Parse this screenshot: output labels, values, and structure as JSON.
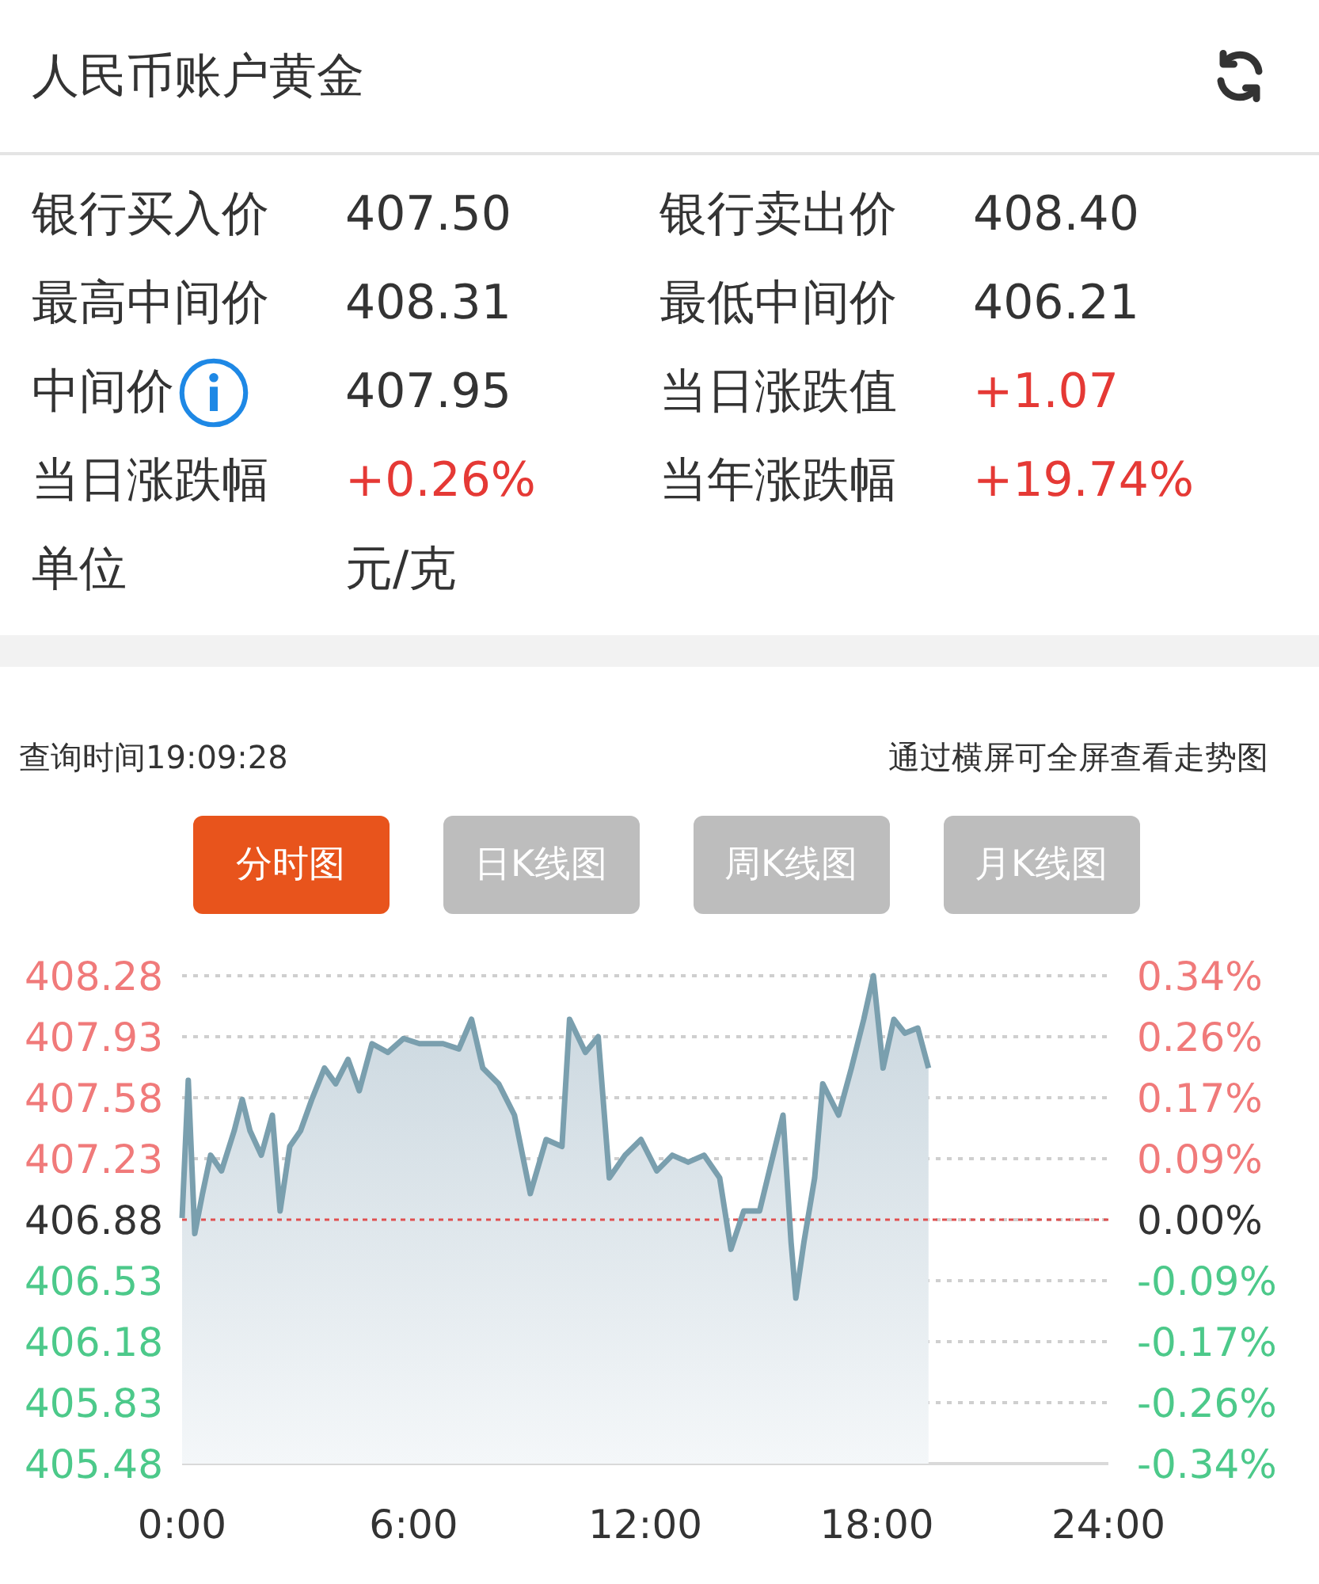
{
  "header": {
    "title": "人民币账户黄金"
  },
  "quotes": [
    {
      "label": "银行买入价",
      "value": "407.50",
      "color": "#333333",
      "info": false
    },
    {
      "label": "银行卖出价",
      "value": "408.40",
      "color": "#333333",
      "info": false
    },
    {
      "label": "最高中间价",
      "value": "408.31",
      "color": "#333333",
      "info": false
    },
    {
      "label": "最低中间价",
      "value": "406.21",
      "color": "#333333",
      "info": false
    },
    {
      "label": "中间价",
      "value": "407.95",
      "color": "#333333",
      "info": true
    },
    {
      "label": "当日涨跌值",
      "value": "+1.07",
      "color": "#e53935",
      "info": false
    },
    {
      "label": "当日涨跌幅",
      "value": "+0.26%",
      "color": "#e53935",
      "info": false
    },
    {
      "label": "当年涨跌幅",
      "value": "+19.74%",
      "color": "#e53935",
      "info": false
    },
    {
      "label": "单位",
      "value": "元/克",
      "color": "#333333",
      "info": false
    }
  ],
  "query_time": "查询时间19:09:28",
  "hint": "通过横屏可全屏查看走势图",
  "tabs": [
    {
      "label": "分时图",
      "selected": true
    },
    {
      "label": "日K线图",
      "selected": false
    },
    {
      "label": "周K线图",
      "selected": false
    },
    {
      "label": "月K线图",
      "selected": false
    }
  ],
  "chart": {
    "right_axis_labels": [
      "0.34%",
      "0.26%",
      "0.17%",
      "0.09%",
      "0.00%",
      "-0.09%",
      "-0.17%",
      "-0.26%",
      "-0.34%"
    ],
    "chart_data": {
      "type": "area",
      "xlim": [
        0,
        24
      ],
      "ylim": [
        405.48,
        408.28
      ],
      "xticks": [
        {
          "value": 0,
          "label": "0:00"
        },
        {
          "value": 6,
          "label": "6:00"
        },
        {
          "value": 12,
          "label": "12:00"
        },
        {
          "value": 18,
          "label": "18:00"
        },
        {
          "value": 24,
          "label": "24:00"
        }
      ],
      "yticks": [
        {
          "value": 408.28,
          "label": "408.28"
        },
        {
          "value": 407.93,
          "label": "407.93"
        },
        {
          "value": 407.58,
          "label": "407.58"
        },
        {
          "value": 407.23,
          "label": "407.23"
        },
        {
          "value": 406.88,
          "label": "406.88"
        },
        {
          "value": 406.53,
          "label": "406.53"
        },
        {
          "value": 406.18,
          "label": "406.18"
        },
        {
          "value": 405.83,
          "label": "405.83"
        },
        {
          "value": 405.48,
          "label": "405.48"
        }
      ],
      "grid": true,
      "ref_lines": [
        {
          "axis": "y",
          "value": 406.88,
          "color": "#e05050"
        }
      ],
      "x": [
        0,
        0.16,
        0.33,
        0.53,
        0.74,
        1.02,
        1.35,
        1.56,
        1.76,
        2.05,
        2.34,
        2.54,
        2.79,
        3.07,
        3.36,
        3.69,
        3.98,
        4.3,
        4.59,
        4.92,
        5.33,
        5.74,
        6.15,
        6.76,
        7.17,
        7.5,
        7.79,
        8.2,
        8.61,
        9.02,
        9.43,
        9.84,
        10.04,
        10.45,
        10.78,
        11.07,
        11.48,
        11.89,
        12.3,
        12.7,
        13.11,
        13.52,
        13.93,
        14.22,
        14.55,
        14.96,
        15.37,
        15.57,
        15.78,
        15.9,
        16.11,
        16.39,
        16.6,
        17.01,
        17.34,
        17.66,
        17.91,
        18.16,
        18.44,
        18.73,
        19.06,
        19.34
      ],
      "series": [
        {
          "color": "#7a9fae",
          "values": [
            406.89,
            407.68,
            406.8,
            407.03,
            407.25,
            407.16,
            407.39,
            407.57,
            407.39,
            407.25,
            407.48,
            406.93,
            407.3,
            407.39,
            407.57,
            407.75,
            407.66,
            407.8,
            407.62,
            407.89,
            407.84,
            407.92,
            407.89,
            407.89,
            407.86,
            408.03,
            407.75,
            407.66,
            407.48,
            407.03,
            407.34,
            407.3,
            408.03,
            407.84,
            407.93,
            407.12,
            407.25,
            407.34,
            407.16,
            407.25,
            407.21,
            407.25,
            407.12,
            406.71,
            406.93,
            406.93,
            407.3,
            407.48,
            406.75,
            406.43,
            406.75,
            407.12,
            407.66,
            407.48,
            407.75,
            408.03,
            408.28,
            407.75,
            408.03,
            407.95,
            407.98,
            407.75
          ]
        }
      ]
    }
  }
}
